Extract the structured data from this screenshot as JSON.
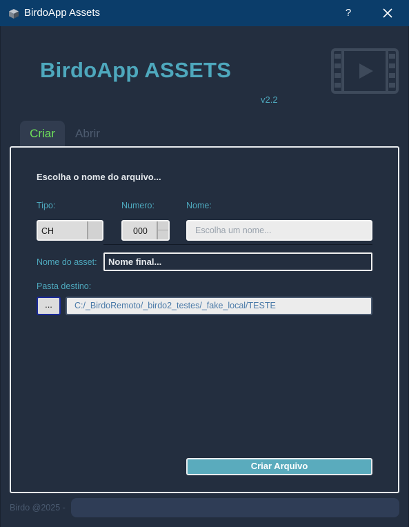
{
  "titlebar": {
    "title": "BirdoApp Assets",
    "help_label": "?",
    "icons": {
      "app": "cube-icon",
      "close": "close-icon"
    }
  },
  "header": {
    "logo_title": "BirdoApp ASSETS",
    "version": "v2.2",
    "icon": "film-play-icon"
  },
  "tabs": [
    {
      "label": "Criar",
      "active": true
    },
    {
      "label": "Abrir",
      "active": false
    }
  ],
  "form": {
    "heading": "Escolha o nome do arquivo...",
    "tipo": {
      "label": "Tipo:",
      "value": "CH"
    },
    "numero": {
      "label": "Numero:",
      "value": "000"
    },
    "nome": {
      "label": "Nome:",
      "placeholder": "Escolha um nome..."
    },
    "asset": {
      "label": "Nome do asset:",
      "value": "Nome final..."
    },
    "pasta": {
      "label": "Pasta destino:",
      "browse_label": "...",
      "value": "C:/_BirdoRemoto/_birdo2_testes/_fake_local/TESTE"
    },
    "create_label": "Criar Arquivo"
  },
  "footer": {
    "text": "Birdo @2025 -"
  },
  "colors": {
    "titlebar": "#0b3d6a",
    "background": "#232e3f",
    "accent": "#4ea8bd",
    "active_tab": "#6ee05a",
    "button": "#5aabbd"
  }
}
